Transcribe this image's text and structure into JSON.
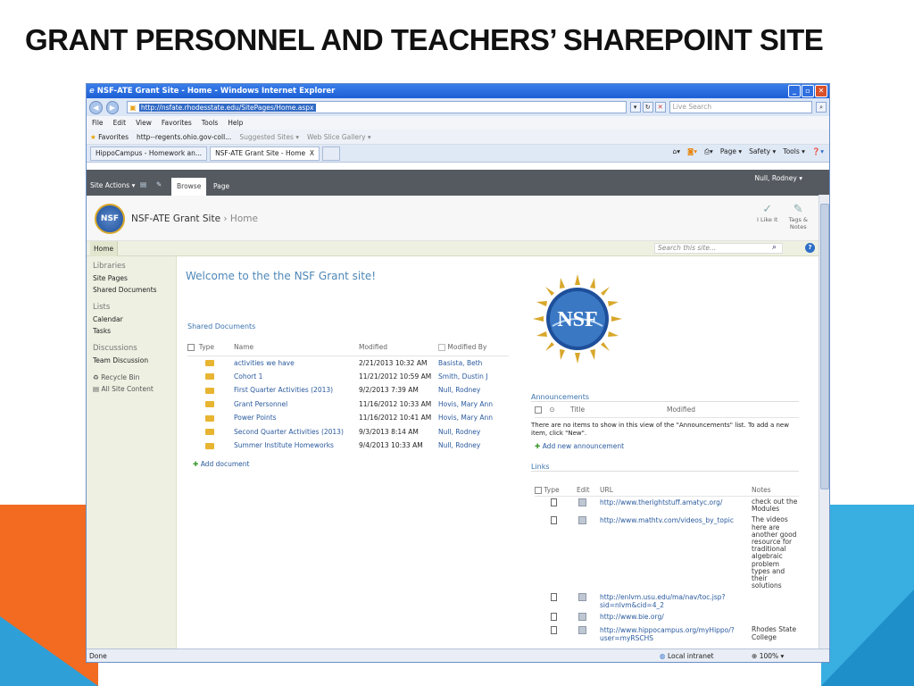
{
  "slide": {
    "title": "GRANT PERSONNEL AND TEACHERS’ SHAREPOINT SITE"
  },
  "browser": {
    "window_title": "NSF-ATE Grant Site - Home - Windows Internet Explorer",
    "address": "http://nsfate.rhodesstate.edu/SitePages/Home.aspx",
    "search_placeholder": "Live Search",
    "menu": [
      "File",
      "Edit",
      "View",
      "Favorites",
      "Tools",
      "Help"
    ],
    "favorites_label": "Favorites",
    "fav_items": [
      "http--regents.ohio.gov-coll...",
      "Suggested Sites ▾",
      "Web Slice Gallery ▾"
    ],
    "tabs": [
      "HippoCampus - Homework an...",
      "NSF-ATE Grant Site - Home"
    ],
    "tab_close": "X",
    "commands": [
      "Page ▾",
      "Safety ▾",
      "Tools ▾"
    ],
    "status": {
      "left": "Done",
      "zone": "Local intranet",
      "zoom": "100%"
    }
  },
  "sharepoint": {
    "ribbon": {
      "site_actions": "Site Actions ▾",
      "browse": "Browse",
      "page": "Page",
      "user": "Null, Rodney ▾"
    },
    "header": {
      "site_title": "NSF-ATE Grant Site",
      "crumb_sep": "›",
      "crumb": "Home",
      "badge": "NSF",
      "like": "I Like It",
      "tags_1": "Tags &",
      "tags_2": "Notes"
    },
    "topnav": {
      "home": "Home",
      "search_placeholder": "Search this site..."
    },
    "left_nav": {
      "libraries": "Libraries",
      "library_items": [
        "Site Pages",
        "Shared Documents"
      ],
      "lists": "Lists",
      "list_items": [
        "Calendar",
        "Tasks"
      ],
      "discussions": "Discussions",
      "discussion_items": [
        "Team Discussion"
      ],
      "recycle_bin": "Recycle Bin",
      "all_content": "All Site Content"
    },
    "welcome": "Welcome to the the NSF Grant site!",
    "shared_docs": {
      "title": "Shared Documents",
      "columns": {
        "type": "Type",
        "name": "Name",
        "modified": "Modified",
        "modified_by": "Modified By"
      },
      "rows": [
        {
          "name": "activities we have",
          "modified": "2/21/2013 10:32 AM",
          "by": "Basista, Beth"
        },
        {
          "name": "Cohort 1",
          "modified": "11/21/2012 10:59 AM",
          "by": "Smith, Dustin J"
        },
        {
          "name": "First Quarter Activities (2013)",
          "modified": "9/2/2013 7:39 AM",
          "by": "Null, Rodney"
        },
        {
          "name": "Grant Personnel",
          "modified": "11/16/2012 10:33 AM",
          "by": "Hovis, Mary Ann"
        },
        {
          "name": "Power Points",
          "modified": "11/16/2012 10:41 AM",
          "by": "Hovis, Mary Ann"
        },
        {
          "name": "Second Quarter Activities (2013)",
          "modified": "9/3/2013 8:14 AM",
          "by": "Null, Rodney"
        },
        {
          "name": "Summer Institute Homeworks",
          "modified": "9/4/2013 10:33 AM",
          "by": "Null, Rodney"
        }
      ],
      "add": "Add document"
    },
    "announcements": {
      "title": "Announcements",
      "columns": {
        "title": "Title",
        "modified": "Modified"
      },
      "empty": "There are no items to show in this view of the \"Announcements\" list. To add a new item, click \"New\".",
      "add": "Add new announcement"
    },
    "links": {
      "title": "Links",
      "columns": {
        "type": "Type",
        "edit": "Edit",
        "url": "URL",
        "notes": "Notes"
      },
      "rows": [
        {
          "url": "http://www.therightstuff.amatyc.org/",
          "notes": "check out the Modules"
        },
        {
          "url": "http://www.mathtv.com/videos_by_topic",
          "notes": "The videos here are another good resource for traditional algebraic problem types and their solutions"
        },
        {
          "url": "http://enlvm.usu.edu/ma/nav/toc.jsp?sid=nlvm&cid=4_2",
          "notes": ""
        },
        {
          "url": "http://www.bie.org/",
          "notes": ""
        },
        {
          "url": "http://www.hippocampus.org/myHippo/?user=myRSCHS",
          "notes": "Rhodes State College"
        }
      ]
    },
    "nsf_logo_text": "NSF"
  }
}
